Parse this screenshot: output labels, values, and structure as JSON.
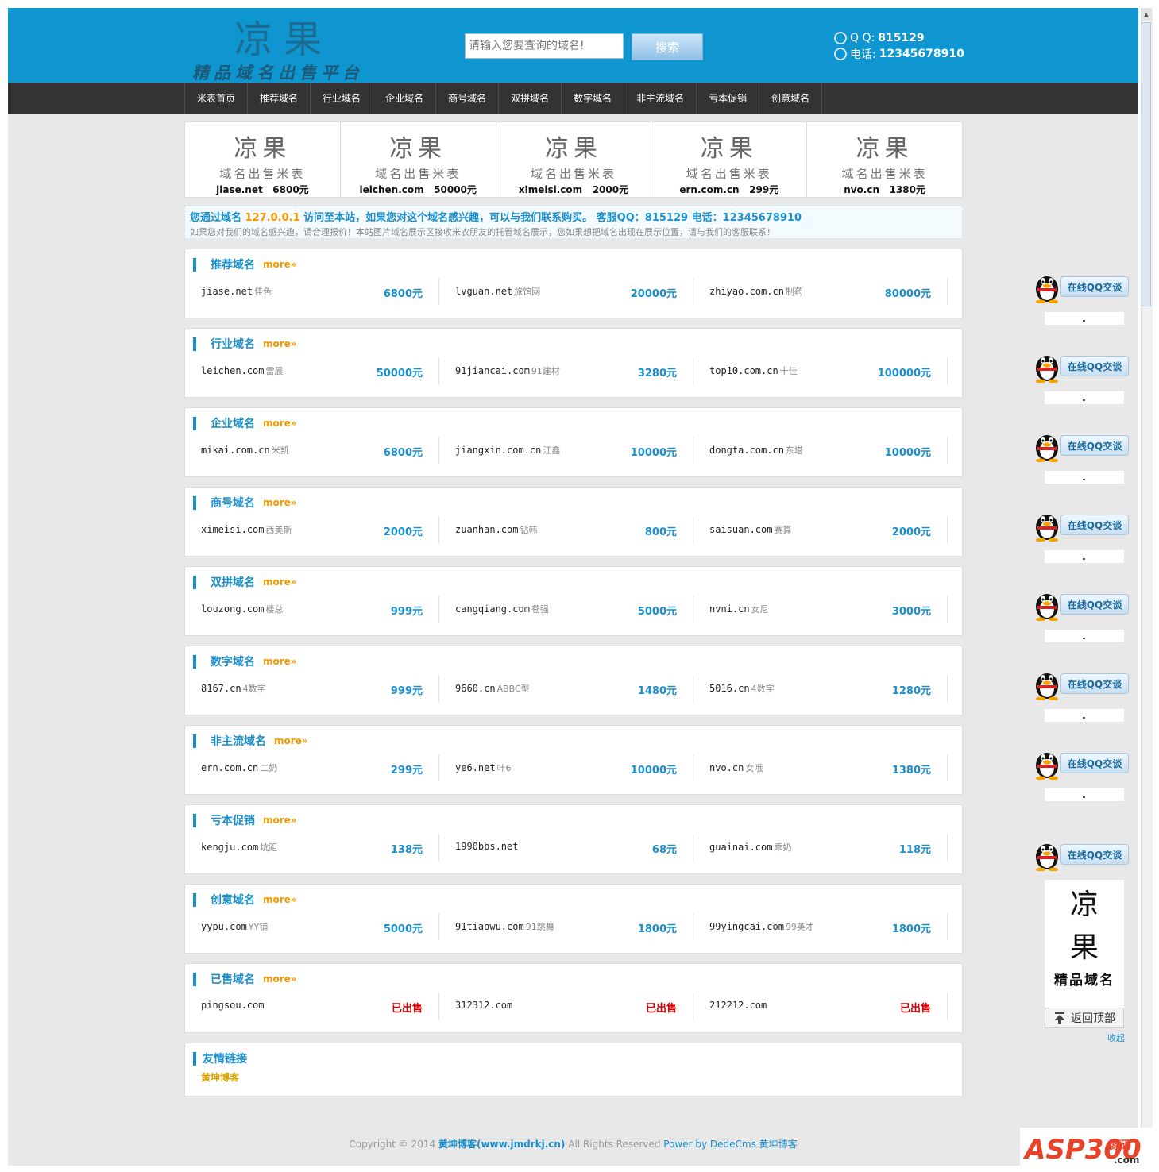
{
  "header": {
    "logo_title": "凉果",
    "logo_subtitle": "精品域名出售平台",
    "search_placeholder": "请输入您要查询的域名!",
    "search_button": "搜索",
    "qq_label": "Q Q:",
    "qq_value": "815129",
    "phone_label": "电话:",
    "phone_value": "12345678910"
  },
  "nav": [
    "米表首页",
    "推荐域名",
    "行业域名",
    "企业域名",
    "商号域名",
    "双拼域名",
    "数字域名",
    "非主流域名",
    "亏本促销",
    "创意域名"
  ],
  "banner": [
    {
      "title": "凉果",
      "subtitle": "域名出售米表",
      "domain": "jiase.net",
      "price": "6800元"
    },
    {
      "title": "凉果",
      "subtitle": "域名出售米表",
      "domain": "leichen.com",
      "price": "50000元"
    },
    {
      "title": "凉果",
      "subtitle": "域名出售米表",
      "domain": "ximeisi.com",
      "price": "2000元"
    },
    {
      "title": "凉果",
      "subtitle": "域名出售米表",
      "domain": "ern.com.cn",
      "price": "299元"
    },
    {
      "title": "凉果",
      "subtitle": "域名出售米表",
      "domain": "nvo.cn",
      "price": "1380元"
    }
  ],
  "notice": {
    "prefix": "您通过域名 ",
    "ip": "127.0.0.1",
    "suffix": " 访问至本站，如果您对这个域名感兴趣，可以与我们联系购买。 客服QQ：815129 电话：12345678910",
    "line2": "如果您对我们的域名感兴趣，请合理报价！本站图片域名展示区接收米农朋友的托管域名展示，您如果想把域名出现在展示位置，请与我们的客服联系！"
  },
  "more_label": "more»",
  "sections": [
    {
      "title": "推荐域名",
      "items": [
        {
          "domain": "jiase.net",
          "cn": "佳色",
          "price": "6800元"
        },
        {
          "domain": "lvguan.net",
          "cn": "旅馆网",
          "price": "20000元"
        },
        {
          "domain": "zhiyao.com.cn",
          "cn": "制药",
          "price": "80000元"
        }
      ]
    },
    {
      "title": "行业域名",
      "items": [
        {
          "domain": "leichen.com",
          "cn": "雷晨",
          "price": "50000元"
        },
        {
          "domain": "91jiancai.com",
          "cn": "91建材",
          "price": "3280元"
        },
        {
          "domain": "top10.com.cn",
          "cn": "十佳",
          "price": "100000元"
        }
      ]
    },
    {
      "title": "企业域名",
      "items": [
        {
          "domain": "mikai.com.cn",
          "cn": "米凯",
          "price": "6800元"
        },
        {
          "domain": "jiangxin.com.cn",
          "cn": "江鑫",
          "price": "10000元"
        },
        {
          "domain": "dongta.com.cn",
          "cn": "东塔",
          "price": "10000元"
        }
      ]
    },
    {
      "title": "商号域名",
      "items": [
        {
          "domain": "ximeisi.com",
          "cn": "西美斯",
          "price": "2000元"
        },
        {
          "domain": "zuanhan.com",
          "cn": "钻韩",
          "price": "800元"
        },
        {
          "domain": "saisuan.com",
          "cn": "赛算",
          "price": "2000元"
        }
      ]
    },
    {
      "title": "双拼域名",
      "items": [
        {
          "domain": "louzong.com",
          "cn": "楼总",
          "price": "999元"
        },
        {
          "domain": "cangqiang.com",
          "cn": "苍强",
          "price": "5000元"
        },
        {
          "domain": "nvni.cn",
          "cn": "女尼",
          "price": "3000元"
        }
      ]
    },
    {
      "title": "数字域名",
      "items": [
        {
          "domain": "8167.cn",
          "cn": "4数字",
          "price": "999元"
        },
        {
          "domain": "9660.cn",
          "cn": "ABBC型",
          "price": "1480元"
        },
        {
          "domain": "5016.cn",
          "cn": "4数字",
          "price": "1280元"
        }
      ]
    },
    {
      "title": "非主流域名",
      "items": [
        {
          "domain": "ern.com.cn",
          "cn": "二奶",
          "price": "299元"
        },
        {
          "domain": "ye6.net",
          "cn": "叶6",
          "price": "10000元"
        },
        {
          "domain": "nvo.cn",
          "cn": "女哦",
          "price": "1380元"
        }
      ]
    },
    {
      "title": "亏本促销",
      "items": [
        {
          "domain": "kengju.com",
          "cn": "坑距",
          "price": "138元"
        },
        {
          "domain": "1990bbs.net",
          "cn": "",
          "price": "68元"
        },
        {
          "domain": "guainai.com",
          "cn": "乖奶",
          "price": "118元"
        }
      ]
    },
    {
      "title": "创意域名",
      "items": [
        {
          "domain": "yypu.com",
          "cn": "YY铺",
          "price": "5000元"
        },
        {
          "domain": "91tiaowu.com",
          "cn": "91跳舞",
          "price": "1800元"
        },
        {
          "domain": "99yingcai.com",
          "cn": "99英才",
          "price": "1800元"
        }
      ]
    },
    {
      "title": "已售域名",
      "sold": true,
      "items": [
        {
          "domain": "pingsou.com",
          "cn": "",
          "price": "已出售"
        },
        {
          "domain": "312312.com",
          "cn": "",
          "price": "已出售"
        },
        {
          "domain": "212212.com",
          "cn": "",
          "price": "已出售"
        }
      ]
    }
  ],
  "links": {
    "title": "友情链接",
    "items": [
      "黄坤博客"
    ]
  },
  "footer": {
    "copyright": "Copyright © 2014 ",
    "site": "黄坤博客(www.jmdrkj.cn)",
    "rights": " All Rights Reserved ",
    "power": "Power by DedeCms 黄坤博客"
  },
  "sidebar": {
    "qq_button": "在线QQ交谈",
    "logo_chars": [
      "凉",
      "果"
    ],
    "logo_sub": "精品域名",
    "back_top": "返回顶部",
    "collapse": "收起"
  },
  "watermark": {
    "brand": "ASP300",
    "cn": "源码",
    "domain": ".com"
  },
  "colors": {
    "header_bg": "#0f95d0",
    "nav_bg": "#333333",
    "accent": "#1b8fcc",
    "more": "#f39800",
    "sold": "#d40000"
  },
  "icons": [
    "qq-icon",
    "phone-icon",
    "qq-penguin-icon",
    "arrow-up-icon"
  ]
}
